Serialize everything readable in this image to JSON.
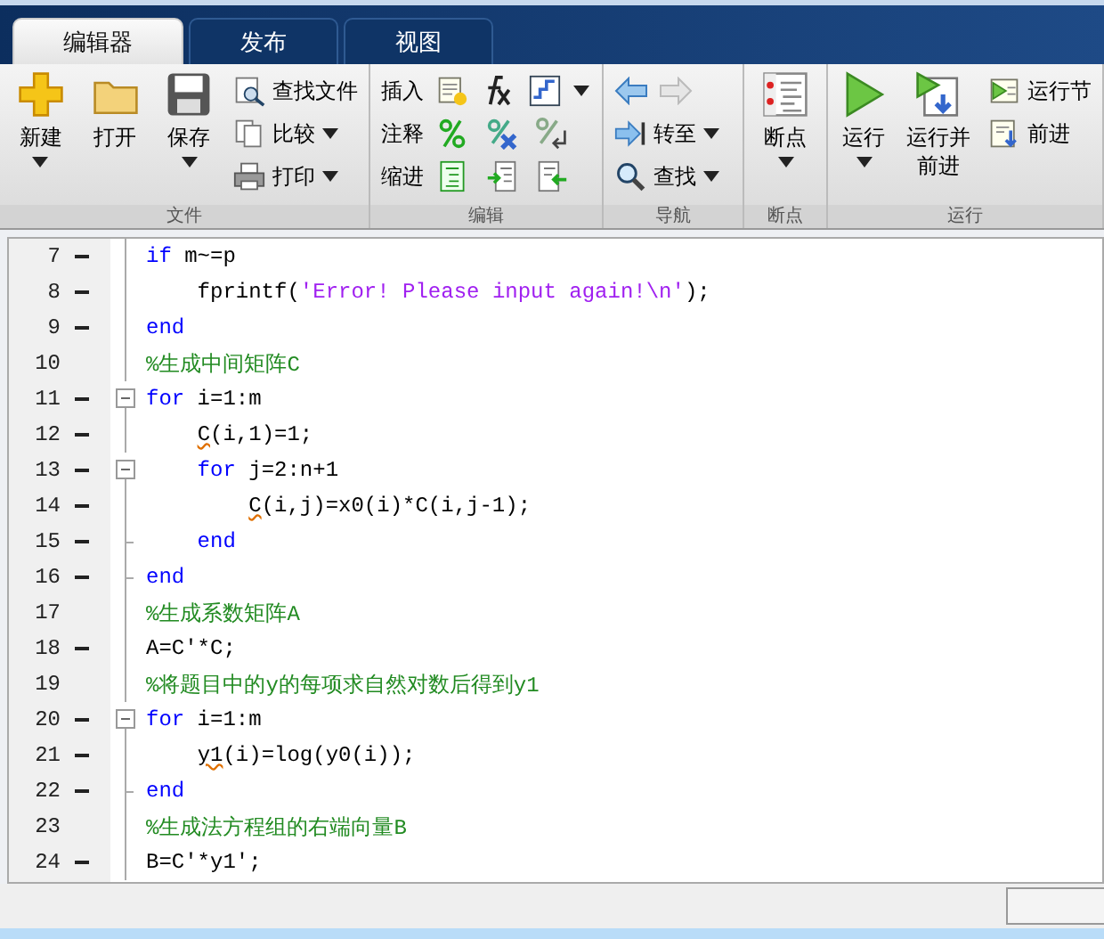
{
  "tabs": [
    {
      "label": "编辑器",
      "selected": true
    },
    {
      "label": "发布",
      "selected": false
    },
    {
      "label": "视图",
      "selected": false
    }
  ],
  "ribbon": [
    {
      "label": "文件",
      "items": [
        {
          "kind": "big",
          "label": "新建",
          "menu": true
        },
        {
          "kind": "big",
          "label": "打开",
          "menu": false
        },
        {
          "kind": "big",
          "label": "保存",
          "menu": true
        },
        {
          "kind": "stack",
          "items": [
            {
              "label": "查找文件",
              "menu": false
            },
            {
              "label": "比较",
              "menu": true
            },
            {
              "label": "打印",
              "menu": true
            }
          ]
        }
      ]
    },
    {
      "label": "编辑",
      "items": [
        {
          "kind": "rows",
          "rows": [
            {
              "label": "插入",
              "menu": true
            },
            {
              "label": "注释",
              "menu": false
            },
            {
              "label": "缩进",
              "menu": false
            }
          ]
        }
      ]
    },
    {
      "label": "导航",
      "items": [
        {
          "kind": "nav",
          "items": [
            {
              "label": "转至",
              "menu": true
            },
            {
              "label": "查找",
              "menu": true
            }
          ]
        }
      ]
    },
    {
      "label": "断点",
      "items": [
        {
          "kind": "big",
          "label": "断点",
          "menu": true
        }
      ]
    },
    {
      "label": "运行",
      "items": [
        {
          "kind": "big",
          "label": "运行",
          "menu": true
        },
        {
          "kind": "big",
          "label": "运行并前进",
          "menu": false
        },
        {
          "kind": "stack",
          "items": [
            {
              "label": "运行节",
              "menu": false
            },
            {
              "label": "前进",
              "menu": false
            }
          ]
        }
      ]
    }
  ],
  "lines": [
    {
      "number": "7",
      "dash": true,
      "kind": "plain",
      "tokens": [
        {
          "kind": "keyword",
          "text": "if"
        },
        {
          "kind": "plain",
          "text": " m~=p"
        }
      ]
    },
    {
      "number": "8",
      "dash": true,
      "kind": "plain",
      "tokens": [
        {
          "kind": "plain",
          "text": "    fprintf("
        },
        {
          "kind": "string",
          "text": "'Error! Please input again!\\n'"
        },
        {
          "kind": "plain",
          "text": ");"
        }
      ]
    },
    {
      "number": "9",
      "dash": true,
      "kind": "plain",
      "tokens": [
        {
          "kind": "keyword",
          "text": "end"
        }
      ]
    },
    {
      "number": "10",
      "dash": false,
      "kind": "plain",
      "tokens": [
        {
          "kind": "comment",
          "text": "%生成中间矩阵C"
        }
      ]
    },
    {
      "number": "11",
      "dash": true,
      "kind": "fold_start",
      "tokens": [
        {
          "kind": "keyword",
          "text": "for"
        },
        {
          "kind": "plain",
          "text": " i=1:m"
        }
      ]
    },
    {
      "number": "12",
      "dash": true,
      "kind": "plain",
      "tokens": [
        {
          "kind": "warn",
          "text": "    C"
        },
        {
          "kind": "plain",
          "text": "(i,1)=1;"
        }
      ]
    },
    {
      "number": "13",
      "dash": true,
      "kind": "fold_start",
      "tokens": [
        {
          "kind": "keyword",
          "text": "    for"
        },
        {
          "kind": "plain",
          "text": " j=2:n+1"
        }
      ]
    },
    {
      "number": "14",
      "dash": true,
      "kind": "plain",
      "tokens": [
        {
          "kind": "warn",
          "text": "        C"
        },
        {
          "kind": "plain",
          "text": "(i,j)=x0(i)*C(i,j-1);"
        }
      ]
    },
    {
      "number": "15",
      "dash": true,
      "kind": "fold_end",
      "tokens": [
        {
          "kind": "keyword",
          "text": "    end"
        }
      ]
    },
    {
      "number": "16",
      "dash": true,
      "kind": "fold_end",
      "tokens": [
        {
          "kind": "keyword",
          "text": "end"
        }
      ]
    },
    {
      "number": "17",
      "dash": false,
      "kind": "plain",
      "tokens": [
        {
          "kind": "comment",
          "text": "%生成系数矩阵A"
        }
      ]
    },
    {
      "number": "18",
      "dash": true,
      "kind": "plain",
      "tokens": [
        {
          "kind": "plain",
          "text": "A=C'*C;"
        }
      ]
    },
    {
      "number": "19",
      "dash": false,
      "kind": "plain",
      "tokens": [
        {
          "kind": "comment",
          "text": "%将题目中的y的每项求自然对数后得到y1"
        }
      ]
    },
    {
      "number": "20",
      "dash": true,
      "kind": "fold_start",
      "tokens": [
        {
          "kind": "keyword",
          "text": "for"
        },
        {
          "kind": "plain",
          "text": " i=1:m"
        }
      ]
    },
    {
      "number": "21",
      "dash": true,
      "kind": "plain",
      "tokens": [
        {
          "kind": "warn",
          "text": "    y1"
        },
        {
          "kind": "plain",
          "text": "(i)=log(y0(i));"
        }
      ]
    },
    {
      "number": "22",
      "dash": true,
      "kind": "fold_end",
      "tokens": [
        {
          "kind": "keyword",
          "text": "end"
        }
      ]
    },
    {
      "number": "23",
      "dash": false,
      "kind": "plain",
      "tokens": [
        {
          "kind": "comment",
          "text": "%生成法方程组的右端向量B"
        }
      ]
    },
    {
      "number": "24",
      "dash": true,
      "kind": "plain",
      "tokens": [
        {
          "kind": "plain",
          "text": "B=C'*y1';"
        }
      ]
    }
  ]
}
